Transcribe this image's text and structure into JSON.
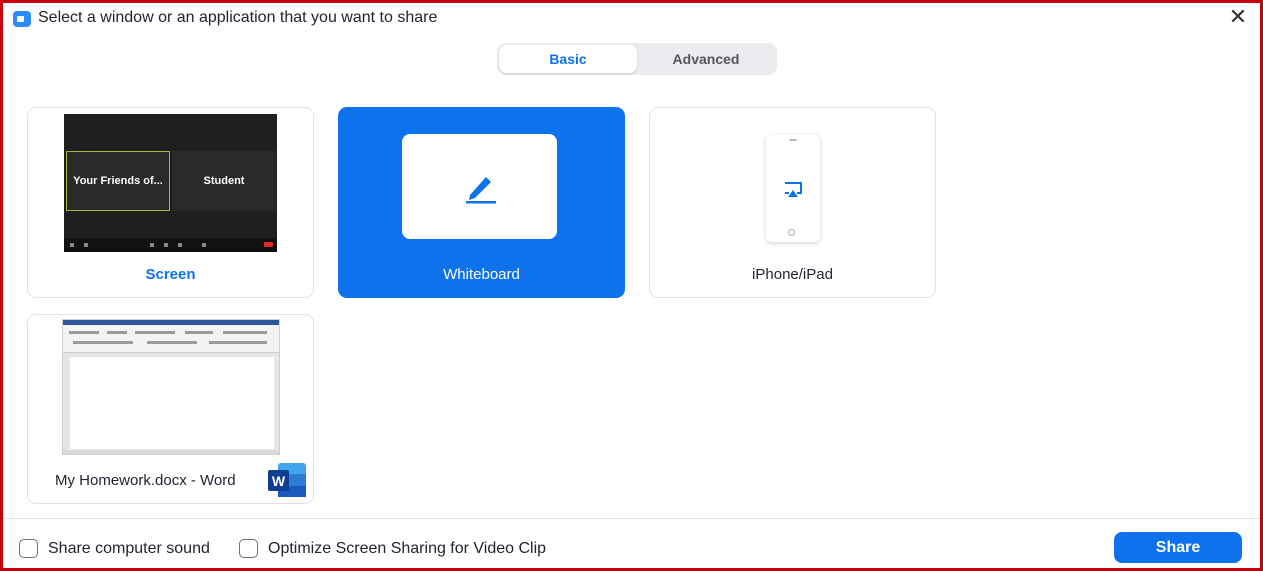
{
  "window": {
    "title": "Select a window or an application that you want to share",
    "close_label": "✕"
  },
  "tabs": [
    {
      "label": "Basic",
      "active": true
    },
    {
      "label": "Advanced",
      "active": false
    }
  ],
  "tiles": {
    "screen": {
      "label": "Screen",
      "thumb_left_pane": "Your Friends of...",
      "thumb_right_pane": "Student"
    },
    "whiteboard": {
      "label": "Whiteboard",
      "icon": "pen-icon",
      "selected": true
    },
    "iphone": {
      "label": "iPhone/iPad",
      "icon": "airplay-icon"
    },
    "word": {
      "label": "My Homework.docx - Word",
      "icon": "word-logo-icon",
      "logo_letter": "W"
    }
  },
  "options": {
    "share_sound": {
      "label": "Share computer sound",
      "checked": false
    },
    "optimize_video": {
      "label": "Optimize Screen Sharing for Video Clip",
      "checked": false
    }
  },
  "actions": {
    "share_label": "Share"
  },
  "colors": {
    "accent": "#0e72ed",
    "frame_border": "#c8000a",
    "word_blue": "#2b579a"
  }
}
